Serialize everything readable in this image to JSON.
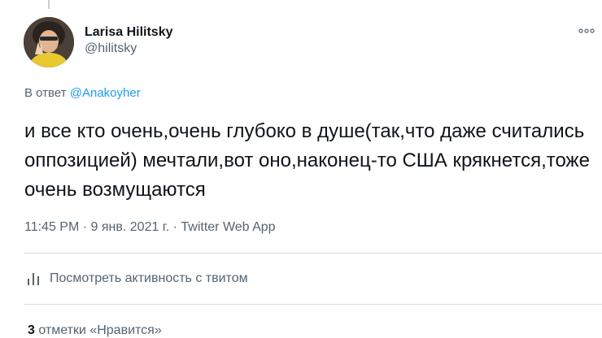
{
  "tweet": {
    "author": {
      "display_name": "Larisa Hilitsky",
      "handle": "@hilitsky"
    },
    "reply_to": {
      "prefix": "В ответ",
      "mention": "@Anakoyher"
    },
    "text": "и все кто очень,очень глубоко в душе(так,что даже считались оппозицией) мечтали,вот оно,наконец-то США крякнется,тоже очень возмущаются",
    "time": "11:45 PM",
    "separator": "·",
    "date": "9 янв. 2021 г.",
    "source_app": "Twitter Web App"
  },
  "actions": {
    "activity_label": "Посмотреть активность с твитом",
    "activity_icon": "bar-chart-icon",
    "more_icon": "more-dots-icon"
  },
  "stats": {
    "likes_count": "3",
    "likes_label": "отметки «Нравится»"
  },
  "colors": {
    "text_primary": "#0f1419",
    "text_secondary": "#536471",
    "link": "#1d9bf0",
    "divider": "#d4dde3"
  }
}
